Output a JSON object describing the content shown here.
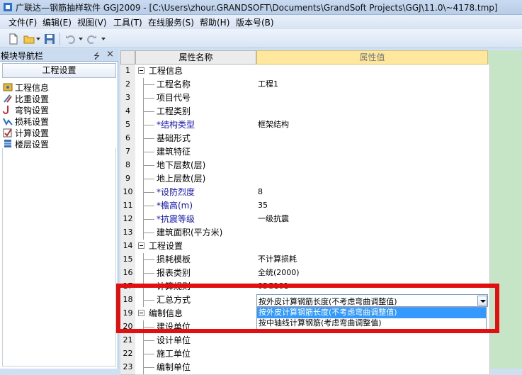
{
  "window": {
    "title": "广联达—钢筋抽样软件 GGJ2009 - [C:\\Users\\zhour.GRANDSOFT\\Documents\\GrandSoft Projects\\GGJ\\11.0\\~4178.tmp]"
  },
  "menu": [
    "文件(F)",
    "编辑(E)",
    "视图(V)",
    "工具(T)",
    "在线服务(S)",
    "帮助(H)",
    "版本号(B)"
  ],
  "nav": {
    "title": "模块导航栏",
    "pin": "ᵖ",
    "close": "×",
    "group": "工程设置",
    "items": [
      "工程信息",
      "比重设置",
      "弯钩设置",
      "损耗设置",
      "计算设置",
      "楼层设置"
    ]
  },
  "grid": {
    "header_name": "属性名称",
    "header_value": "属性值",
    "rows": [
      {
        "n": "1",
        "name": "工程信息",
        "value": "",
        "cat": true
      },
      {
        "n": "2",
        "name": "工程名称",
        "value": "工程1"
      },
      {
        "n": "3",
        "name": "项目代号",
        "value": ""
      },
      {
        "n": "4",
        "name": "工程类别",
        "value": ""
      },
      {
        "n": "5",
        "name": "*结构类型",
        "value": "框架结构",
        "req": true
      },
      {
        "n": "6",
        "name": "基础形式",
        "value": ""
      },
      {
        "n": "7",
        "name": "建筑特征",
        "value": ""
      },
      {
        "n": "8",
        "name": "地下层数(层)",
        "value": ""
      },
      {
        "n": "9",
        "name": "地上层数(层)",
        "value": ""
      },
      {
        "n": "10",
        "name": "*设防烈度",
        "value": "8",
        "req": true
      },
      {
        "n": "11",
        "name": "*檐高(m)",
        "value": "35",
        "req": true
      },
      {
        "n": "12",
        "name": "*抗震等级",
        "value": "一级抗震",
        "req": true
      },
      {
        "n": "13",
        "name": "建筑面积(平方米)",
        "value": ""
      },
      {
        "n": "14",
        "name": "工程设置",
        "value": "",
        "cat": true
      },
      {
        "n": "15",
        "name": "损耗模板",
        "value": "不计算损耗"
      },
      {
        "n": "16",
        "name": "报表类别",
        "value": "全统(2000)"
      },
      {
        "n": "17",
        "name": "计算规则",
        "value": "03G101"
      },
      {
        "n": "18",
        "name": "汇总方式",
        "value": ""
      },
      {
        "n": "19",
        "name": "编制信息",
        "value": "",
        "cat": true
      },
      {
        "n": "20",
        "name": "建设单位",
        "value": ""
      },
      {
        "n": "21",
        "name": "设计单位",
        "value": ""
      },
      {
        "n": "22",
        "name": "施工单位",
        "value": ""
      },
      {
        "n": "23",
        "name": "编制单位",
        "value": ""
      }
    ]
  },
  "dropdown": {
    "selected": "按外皮计算钢筋长度(不考虑弯曲调整值)",
    "options": [
      "按外皮计算钢筋长度(不考虑弯曲调整值)",
      "按中轴线计算钢筋(考虑弯曲调整值)"
    ]
  },
  "colors": {
    "highlight": "#e01010",
    "selected_option": "#3399ff",
    "value_header": "#ffe79d"
  }
}
